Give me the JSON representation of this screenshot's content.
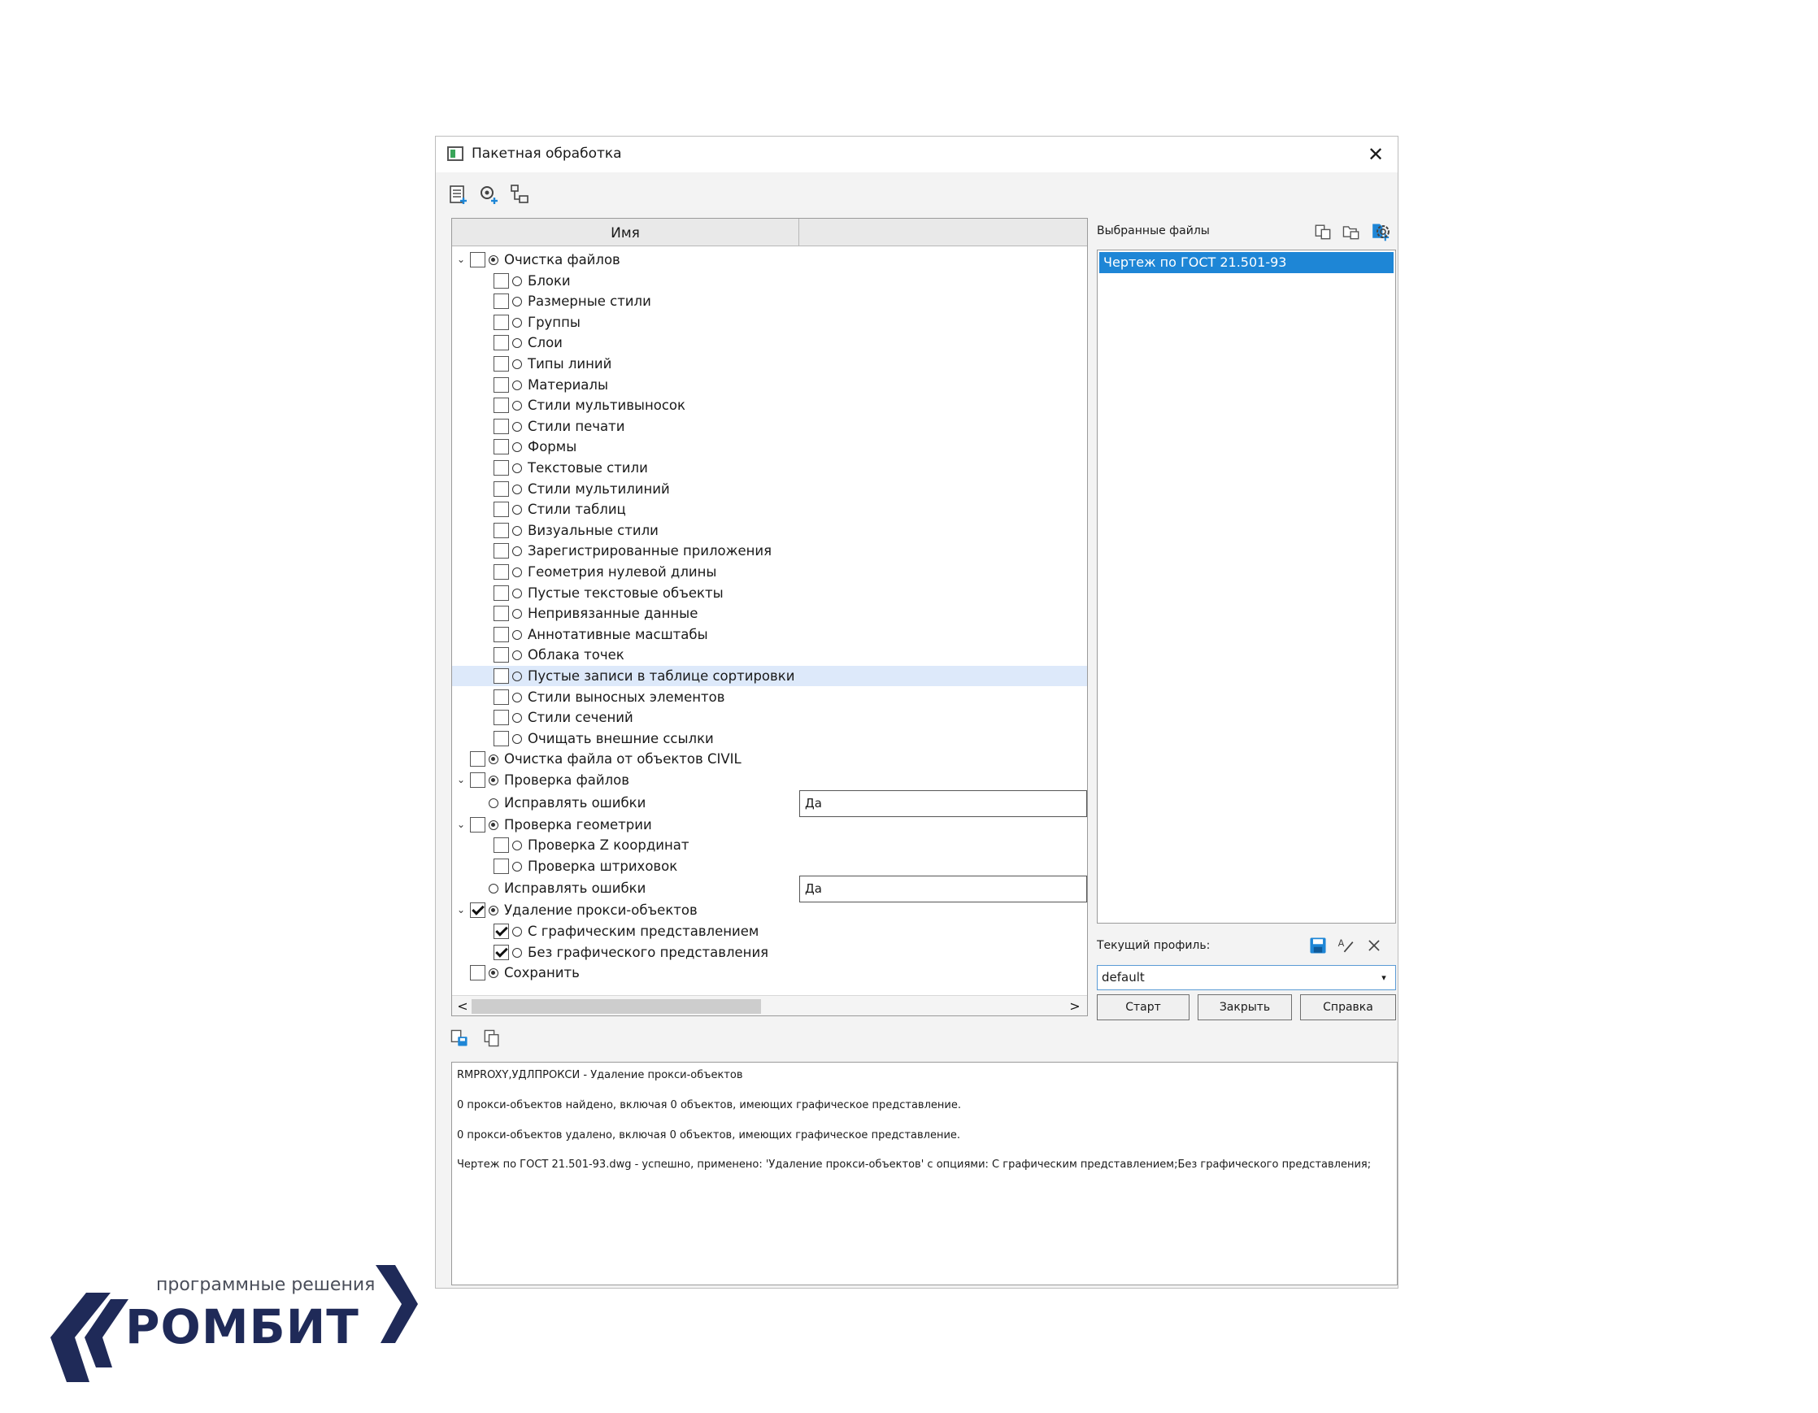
{
  "window": {
    "title": "Пакетная обработка"
  },
  "tree": {
    "column_name": "Имя",
    "rows": [
      {
        "label": "Очистка файлов",
        "level": 0,
        "twisty": "⌄",
        "checkbox": true,
        "checked": false,
        "icon": "gear"
      },
      {
        "label": "Блоки",
        "level": 1,
        "checkbox": true,
        "checked": false,
        "icon": "circle"
      },
      {
        "label": "Размерные стили",
        "level": 1,
        "checkbox": true,
        "checked": false,
        "icon": "circle"
      },
      {
        "label": "Группы",
        "level": 1,
        "checkbox": true,
        "checked": false,
        "icon": "circle"
      },
      {
        "label": "Слои",
        "level": 1,
        "checkbox": true,
        "checked": false,
        "icon": "circle"
      },
      {
        "label": "Типы линий",
        "level": 1,
        "checkbox": true,
        "checked": false,
        "icon": "circle"
      },
      {
        "label": "Материалы",
        "level": 1,
        "checkbox": true,
        "checked": false,
        "icon": "circle"
      },
      {
        "label": "Стили мультивыносок",
        "level": 1,
        "checkbox": true,
        "checked": false,
        "icon": "circle"
      },
      {
        "label": "Стили печати",
        "level": 1,
        "checkbox": true,
        "checked": false,
        "icon": "circle"
      },
      {
        "label": "Формы",
        "level": 1,
        "checkbox": true,
        "checked": false,
        "icon": "circle"
      },
      {
        "label": "Текстовые стили",
        "level": 1,
        "checkbox": true,
        "checked": false,
        "icon": "circle"
      },
      {
        "label": "Стили мультилиний",
        "level": 1,
        "checkbox": true,
        "checked": false,
        "icon": "circle"
      },
      {
        "label": "Стили таблиц",
        "level": 1,
        "checkbox": true,
        "checked": false,
        "icon": "circle"
      },
      {
        "label": "Визуальные стили",
        "level": 1,
        "checkbox": true,
        "checked": false,
        "icon": "circle"
      },
      {
        "label": "Зарегистрированные приложения",
        "level": 1,
        "checkbox": true,
        "checked": false,
        "icon": "circle"
      },
      {
        "label": "Геометрия нулевой длины",
        "level": 1,
        "checkbox": true,
        "checked": false,
        "icon": "circle"
      },
      {
        "label": "Пустые текстовые объекты",
        "level": 1,
        "checkbox": true,
        "checked": false,
        "icon": "circle"
      },
      {
        "label": "Непривязанные данные",
        "level": 1,
        "checkbox": true,
        "checked": false,
        "icon": "circle"
      },
      {
        "label": "Аннотативные масштабы",
        "level": 1,
        "checkbox": true,
        "checked": false,
        "icon": "circle"
      },
      {
        "label": "Облака точек",
        "level": 1,
        "checkbox": true,
        "checked": false,
        "icon": "circle"
      },
      {
        "label": "Пустые записи в таблице сортировки",
        "level": 1,
        "checkbox": true,
        "checked": false,
        "icon": "circle",
        "highlight": true
      },
      {
        "label": "Стили выносных элементов",
        "level": 1,
        "checkbox": true,
        "checked": false,
        "icon": "circle"
      },
      {
        "label": "Стили сечений",
        "level": 1,
        "checkbox": true,
        "checked": false,
        "icon": "circle"
      },
      {
        "label": "Очищать внешние ссылки",
        "level": 1,
        "checkbox": true,
        "checked": false,
        "icon": "circle"
      },
      {
        "label": "Очистка файла от объектов CIVIL",
        "level": 0,
        "checkbox": true,
        "checked": false,
        "icon": "gear"
      },
      {
        "label": "Проверка файлов",
        "level": 0,
        "twisty": "⌄",
        "checkbox": true,
        "checked": false,
        "icon": "gear"
      },
      {
        "label": "Исправлять ошибки",
        "level": 0,
        "checkbox": false,
        "icon": "circle",
        "value": "Да",
        "tall": true
      },
      {
        "label": "Проверка геометрии",
        "level": 0,
        "twisty": "⌄",
        "checkbox": true,
        "checked": false,
        "icon": "gear"
      },
      {
        "label": "Проверка Z координат",
        "level": 1,
        "checkbox": true,
        "checked": false,
        "icon": "circle"
      },
      {
        "label": "Проверка штриховок",
        "level": 1,
        "checkbox": true,
        "checked": false,
        "icon": "circle"
      },
      {
        "label": "Исправлять ошибки",
        "level": 0,
        "checkbox": false,
        "icon": "circle",
        "value": "Да",
        "tall": true
      },
      {
        "label": "Удаление прокси-объектов",
        "level": 0,
        "twisty": "⌄",
        "checkbox": true,
        "checked": true,
        "icon": "gear"
      },
      {
        "label": "С графическим представлением",
        "level": 1,
        "checkbox": true,
        "checked": true,
        "icon": "circle"
      },
      {
        "label": "Без графического представления",
        "level": 1,
        "checkbox": true,
        "checked": true,
        "icon": "circle"
      },
      {
        "label": "Сохранить",
        "level": 0,
        "checkbox": true,
        "checked": false,
        "icon": "gear"
      }
    ],
    "scroll_left": "<",
    "scroll_right": ">"
  },
  "right": {
    "selected_files_label": "Выбранные файлы",
    "files": [
      "Чертеж по ГОСТ 21.501-93"
    ],
    "profile_label": "Текущий профиль:",
    "profile_value": "default",
    "profile_arrow": "▾",
    "buttons": {
      "start": "Старт",
      "close": "Закрыть",
      "help": "Справка"
    }
  },
  "log": {
    "lines": [
      "RMPROXY,УДЛПРОКСИ - Удаление прокси-объектов",
      "0 прокси-объектов найдено, включая 0 объектов, имеющих графическое представление.",
      "0 прокси-объектов удалено, включая 0 объектов, имеющих графическое представление.",
      "Чертеж по ГОСТ 21.501-93.dwg - успешно, применено: 'Удаление прокси-объектов' с опциями: С графическим представлением;Без графического представления;"
    ]
  },
  "logo": {
    "subtitle": "программные решения",
    "name": "РОМБИТ"
  },
  "colors": {
    "selection": "#1e86d6",
    "row_highlight": "#dde9fa",
    "logo_navy": "#1f2a58"
  },
  "icons": {
    "toolbar": [
      "add-list-icon",
      "settings-add-icon",
      "tree-icon"
    ],
    "files": [
      "add-file-icon",
      "add-folder-icon",
      "new-file-icon",
      "gear-icon"
    ],
    "profile": [
      "save-icon",
      "rename-icon",
      "delete-icon"
    ],
    "log": [
      "save-log-icon",
      "copy-icon"
    ]
  }
}
